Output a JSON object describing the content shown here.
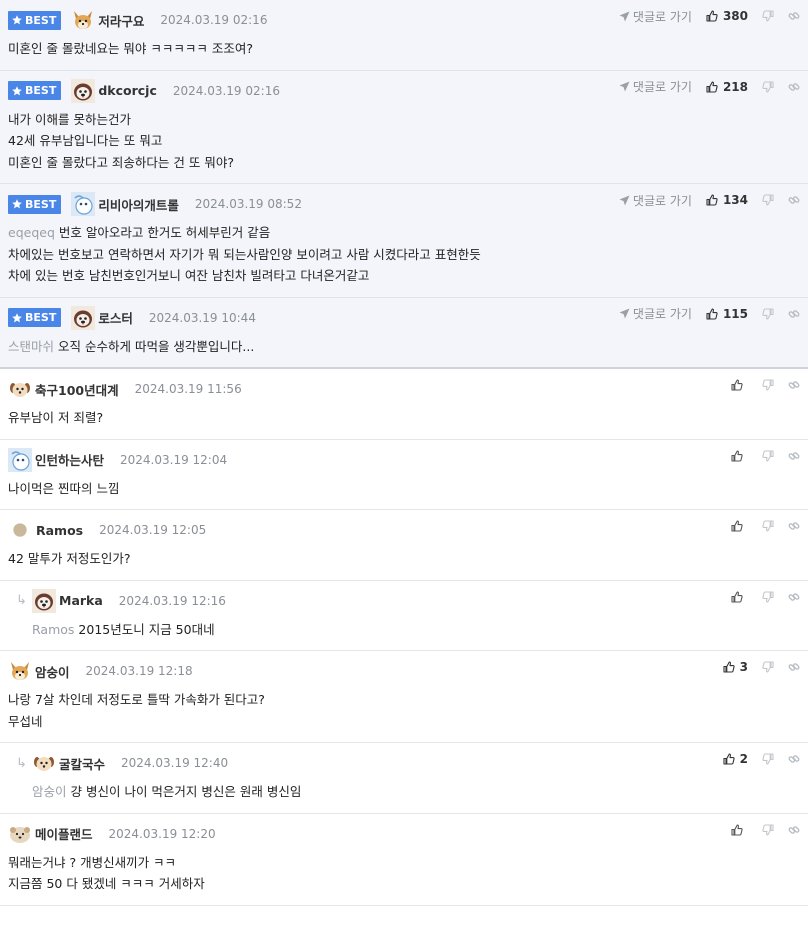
{
  "labels": {
    "best": "BEST",
    "goto_reply": "댓글로 가기"
  },
  "best_comments": [
    {
      "nick": "저라구요",
      "avatar": "shiba-avatar",
      "date": "2024.03.19 02:16",
      "likes": "380",
      "lines": [
        "미혼인 줄 몰랐네요는 뭐야 ㅋㅋㅋㅋㅋ 조조여?"
      ],
      "mention": ""
    },
    {
      "nick": "dkcorcjc",
      "avatar": "pug-avatar",
      "date": "2024.03.19 02:16",
      "likes": "218",
      "lines": [
        "내가 이해를 못하는건가",
        "42세 유부남입니다는 또 뭐고",
        "미혼인 줄 몰랐다고 죄송하다는 건 또 뭐야?"
      ],
      "mention": ""
    },
    {
      "nick": "리비아의개트롤",
      "avatar": "blue-avatar",
      "date": "2024.03.19 08:52",
      "likes": "134",
      "lines": [
        "번호 알아오라고 한거도 허세부린거 같음",
        "차에있는 번호보고 연락하면서 자기가 뭐 되는사람인양 보이려고 사람 시켰다라고 표현한듯",
        "차에 있는 번호 남친번호인거보니 여잔 남친차 빌려타고 다녀온거같고"
      ],
      "mention": "eqeqeq"
    },
    {
      "nick": "로스터",
      "avatar": "pug-avatar",
      "date": "2024.03.19 10:44",
      "likes": "115",
      "lines": [
        "오직 순수하게 따먹을 생각뿐입니다..."
      ],
      "mention": "스탠마쉬"
    }
  ],
  "comments": [
    {
      "nick": "축구100년대계",
      "avatar": "dog-avatar",
      "date": "2024.03.19 11:56",
      "likes": "",
      "reply": false,
      "lines": [
        "유부남이 저 죄렬?"
      ],
      "mention": ""
    },
    {
      "nick": "인턴하는사탄",
      "avatar": "blue-avatar",
      "date": "2024.03.19 12:04",
      "likes": "",
      "reply": false,
      "lines": [
        "나이먹은 찐따의 느낌"
      ],
      "mention": ""
    },
    {
      "nick": "Ramos",
      "avatar": "circle-avatar",
      "date": "2024.03.19 12:05",
      "likes": "",
      "reply": false,
      "lines": [
        "42 말투가 저정도인가?"
      ],
      "mention": ""
    },
    {
      "nick": "Marka",
      "avatar": "pug-avatar",
      "date": "2024.03.19 12:16",
      "likes": "",
      "reply": true,
      "lines": [
        "2015년도니 지금 50대네"
      ],
      "mention": "Ramos"
    },
    {
      "nick": "암숭이",
      "avatar": "shiba-avatar",
      "date": "2024.03.19 12:18",
      "likes": "3",
      "reply": false,
      "lines": [
        "나랑 7살 차인데 저정도로 틀딱 가속화가 된다고?",
        "무섭네"
      ],
      "mention": ""
    },
    {
      "nick": "굴칼국수",
      "avatar": "dog-avatar",
      "date": "2024.03.19 12:40",
      "likes": "2",
      "reply": true,
      "lines": [
        "걍 병신이 나이 먹은거지 병신은 원래 병신임"
      ],
      "mention": "암숭이"
    },
    {
      "nick": "메이플랜드",
      "avatar": "seal-avatar",
      "date": "2024.03.19 12:20",
      "likes": "",
      "reply": false,
      "lines": [
        "뭐래는거냐 ? 개병신새끼가 ㅋㅋ",
        "지금쯤 50 다 됐겠네 ㅋㅋㅋ 거세하자"
      ],
      "mention": ""
    }
  ]
}
